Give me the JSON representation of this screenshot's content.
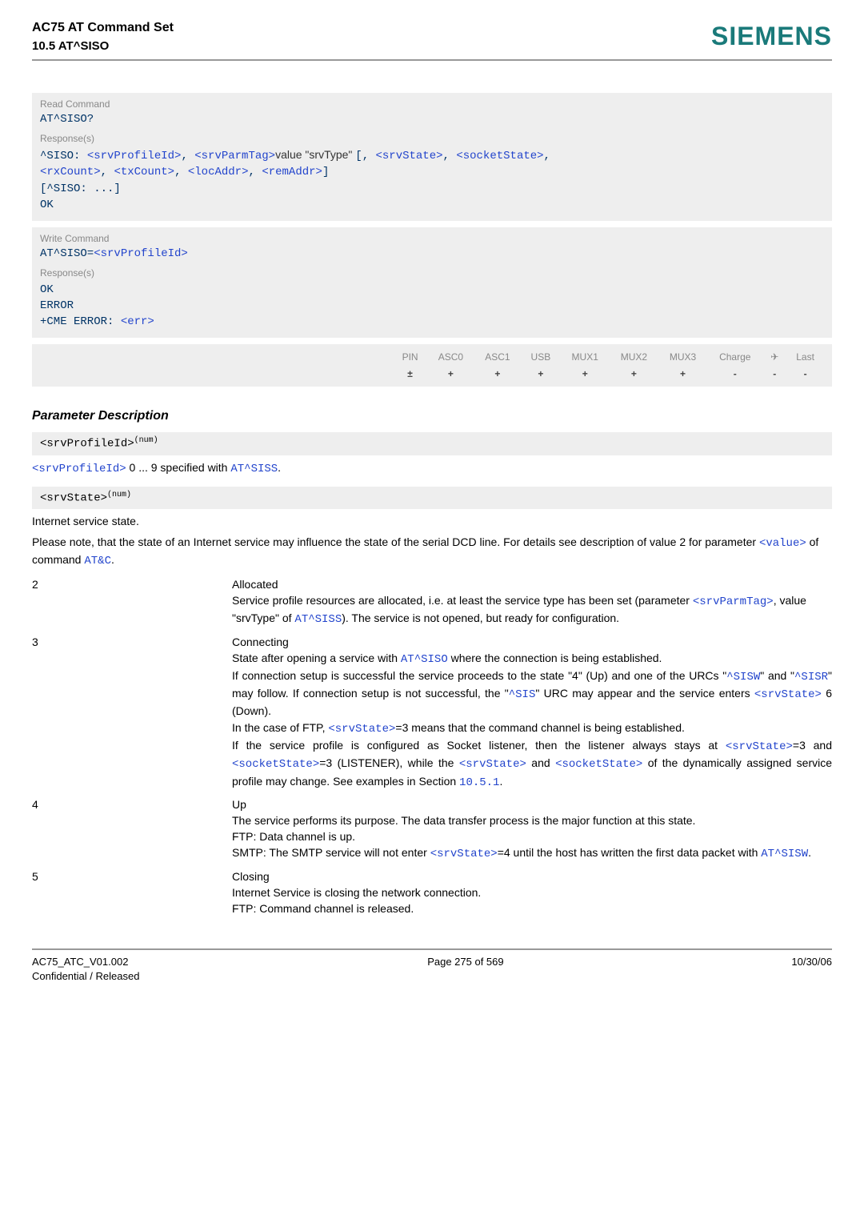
{
  "header": {
    "line1": "AC75 AT Command Set",
    "line2": "10.5 AT^SISO",
    "brand": "SIEMENS"
  },
  "readCmd": {
    "title": "Read Command",
    "cmd": "AT^SISO?",
    "respTitle": "Response(s)",
    "prefix": "^SISO: ",
    "tags": {
      "srvProfileId": "<srvProfileId>",
      "srvParmTag": "<srvParmTag>",
      "srvState": "<srvState>",
      "socketState": "<socketState>",
      "rxCount": "<rxCount>",
      "txCount": "<txCount>",
      "locAddr": "<locAddr>",
      "remAddr": "<remAddr>"
    },
    "valueLabel": "value \"srvType\" ",
    "commaOpen": ", ",
    "openBracket": "[",
    "closeBracket": "]",
    "cont": "[^SISO: ...]",
    "ok": "OK"
  },
  "writeCmd": {
    "title": "Write Command",
    "cmdPrefix": "AT^SISO=",
    "cmdTag": "<srvProfileId>",
    "respTitle": "Response(s)",
    "ok": "OK",
    "error": "ERROR",
    "cmePrefix": "+CME ERROR: ",
    "cmeTag": "<err>"
  },
  "compat": {
    "cols": [
      "PIN",
      "ASC0",
      "ASC1",
      "USB",
      "MUX1",
      "MUX2",
      "MUX3",
      "Charge",
      "",
      "Last"
    ],
    "vals": [
      "±",
      "+",
      "+",
      "+",
      "+",
      "+",
      "+",
      "-",
      "-",
      "-"
    ],
    "plane": "✈"
  },
  "paramDescTitle": "Parameter Description",
  "param1": {
    "name": "<srvProfileId>",
    "sup": "(num)",
    "tag": "<srvProfileId>",
    "text1": " 0 ... 9 specified with ",
    "at": "AT^SISS",
    "dot": "."
  },
  "param2": {
    "name": "<srvState>",
    "sup": "(num)"
  },
  "intro": {
    "l1": "Internet service state.",
    "l2a": "Please note, that the state of an Internet service may influence the state of the serial DCD line. For details see description of value 2 for parameter ",
    "valTag": "<value>",
    "l2b": " of command ",
    "atc": "AT&C",
    "dot": "."
  },
  "states": {
    "s2": {
      "key": "2",
      "title": "Allocated",
      "p1a": "Service profile resources are allocated, i.e. at least the service type has been set (parameter ",
      "tag1": "<srvParmTag>",
      "p1b": ", value \"srvType\" of ",
      "at": "AT^SISS",
      "p1c": "). The service is not opened, but ready for configuration."
    },
    "s3": {
      "key": "3",
      "title": "Connecting",
      "p1a": "State after opening a service with ",
      "at1": "AT^SISO",
      "p1b": " where the connection is being established.",
      "p2a": "If connection setup is successful the service proceeds to the state \"4\" (Up) and one of the URCs \"",
      "urc1": "^SISW",
      "p2b": "\" and \"",
      "urc2": "^SISR",
      "p2c": "\" may follow. If connection setup is not successful, the \"",
      "urc3": "^SIS",
      "p2d": "\" URC may appear and the service enters ",
      "tagSS": "<srvState>",
      "p2e": " 6 (Down).",
      "p3a": "In the case of FTP, ",
      "p3b": "=3 means that the command channel is being established.",
      "p4a": "If the service profile is configured as Socket listener, then the listener always stays at ",
      "p4b": "=3 and ",
      "tagSock": "<socketState>",
      "p4c": "=3 (LISTENER), while the ",
      "p4d": " and ",
      "p4e": " of the dynamically assigned service profile may change. See examples in Section ",
      "sec": "10.5.1",
      "dot": "."
    },
    "s4": {
      "key": "4",
      "title": "Up",
      "p1": "The service performs its purpose. The data transfer process is the major function at this state.",
      "p2": "FTP: Data channel is up.",
      "p3a": "SMTP: The SMTP service will not enter ",
      "tagSS": "<srvState>",
      "p3b": "=4 until the host has written the first data packet with ",
      "at": "AT^SISW",
      "dot": "."
    },
    "s5": {
      "key": "5",
      "title": "Closing",
      "p1": "Internet Service is closing the network connection.",
      "p2": "FTP: Command channel is released."
    }
  },
  "footer": {
    "l1": "AC75_ATC_V01.002",
    "l2": "Confidential / Released",
    "mid": "Page 275 of 569",
    "right": "10/30/06"
  }
}
